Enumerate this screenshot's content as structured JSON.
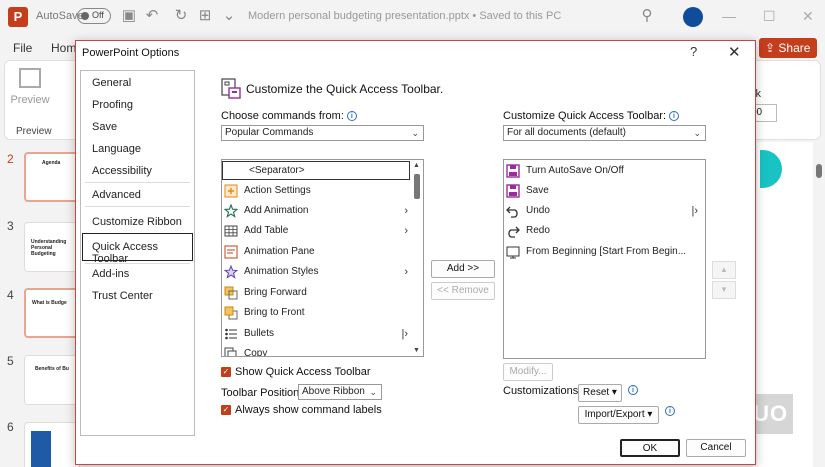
{
  "app": {
    "autosave_label": "AutoSave",
    "autosave_state": "Off",
    "doc_title": "Modern personal budgeting presentation.pptx • Saved to this PC",
    "menu_tabs": [
      "File",
      "Hom"
    ],
    "share_label": "Share",
    "preview_label": "Preview",
    "preview_group_label": "Preview",
    "ribbon_right_a": "ck",
    "ribbon_right_b": "00",
    "slide_numbers": [
      "2",
      "3",
      "4",
      "5",
      "6"
    ],
    "slide_titles": [
      "Agenda",
      "Understanding Personal Budgeting",
      "What is Budge",
      "Benefits of Bu",
      ""
    ],
    "watermark": "MUO"
  },
  "dialog": {
    "title": "PowerPoint Options",
    "help": "?",
    "close": "✕",
    "nav": [
      "General",
      "Proofing",
      "Save",
      "Language",
      "Accessibility",
      "Advanced",
      "Customize Ribbon",
      "Quick Access Toolbar",
      "Add-ins",
      "Trust Center"
    ],
    "selected_nav": "Quick Access Toolbar",
    "heading": "Customize the Quick Access Toolbar.",
    "choose_label": "Choose commands from:",
    "choose_value": "Popular Commands",
    "customize_label": "Customize Quick Access Toolbar:",
    "customize_value": "For all documents (default)",
    "commands": [
      {
        "label": "<Separator>",
        "icon": "separator",
        "sub": ""
      },
      {
        "label": "Action Settings",
        "icon": "action-settings-icon",
        "sub": ""
      },
      {
        "label": "Add Animation",
        "icon": "star-icon",
        "sub": "›"
      },
      {
        "label": "Add Table",
        "icon": "table-icon",
        "sub": "›"
      },
      {
        "label": "Animation Pane",
        "icon": "animation-pane-icon",
        "sub": ""
      },
      {
        "label": "Animation Styles",
        "icon": "animation-styles-icon",
        "sub": "›"
      },
      {
        "label": "Bring Forward",
        "icon": "bring-forward-icon",
        "sub": ""
      },
      {
        "label": "Bring to Front",
        "icon": "bring-to-front-icon",
        "sub": ""
      },
      {
        "label": "Bullets",
        "icon": "bullets-icon",
        "sub": "|›"
      },
      {
        "label": "Copy",
        "icon": "copy-icon",
        "sub": ""
      }
    ],
    "toolbar_items": [
      {
        "label": "Turn AutoSave On/Off",
        "icon": "save-icon",
        "sub": ""
      },
      {
        "label": "Save",
        "icon": "save-icon",
        "sub": ""
      },
      {
        "label": "Undo",
        "icon": "undo-icon",
        "sub": "|›"
      },
      {
        "label": "Redo",
        "icon": "redo-icon",
        "sub": ""
      },
      {
        "label": "From Beginning [Start From Begin...",
        "icon": "slideshow-icon",
        "sub": ""
      }
    ],
    "add_button": "Add >>",
    "remove_button": "<< Remove",
    "modify_button": "Modify...",
    "customizations_label": "Customizations:",
    "reset_button": "Reset ▾",
    "import_export_button": "Import/Export ▾",
    "show_qat_label": "Show Quick Access Toolbar",
    "toolbar_position_label": "Toolbar Position",
    "toolbar_position_value": "Above Ribbon",
    "always_show_labels": "Always show command labels",
    "ok_button": "OK",
    "cancel_button": "Cancel"
  },
  "colors": {
    "accent": "#c43e1c",
    "selected_border": "#222222",
    "info_blue": "#2b6cc4",
    "save_purple": "#9c2aa0"
  }
}
